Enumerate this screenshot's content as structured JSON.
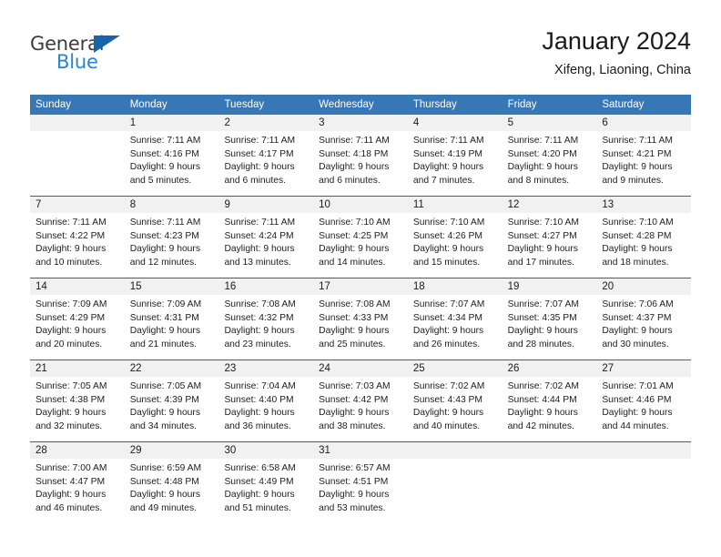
{
  "branding": {
    "name_part1": "General",
    "name_part2": "Blue",
    "triangle_icon": "triangle-icon",
    "accent_color": "#2c83cc",
    "logo_dark_color": "#3c3c3c"
  },
  "header": {
    "title": "January 2024",
    "subtitle": "Xifeng, Liaoning, China"
  },
  "theme": {
    "header_bg": "#3877b5",
    "header_text": "#ffffff",
    "week_divider": "#2167a8",
    "day_number_bg": "#f1f1f1"
  },
  "weekdays": [
    "Sunday",
    "Monday",
    "Tuesday",
    "Wednesday",
    "Thursday",
    "Friday",
    "Saturday"
  ],
  "weeks": [
    {
      "days": [
        {
          "num": "",
          "sunrise": "",
          "sunset": "",
          "daylight": "",
          "empty": true
        },
        {
          "num": "1",
          "sunrise": "Sunrise: 7:11 AM",
          "sunset": "Sunset: 4:16 PM",
          "daylight": "Daylight: 9 hours and 5 minutes.",
          "empty": false
        },
        {
          "num": "2",
          "sunrise": "Sunrise: 7:11 AM",
          "sunset": "Sunset: 4:17 PM",
          "daylight": "Daylight: 9 hours and 6 minutes.",
          "empty": false
        },
        {
          "num": "3",
          "sunrise": "Sunrise: 7:11 AM",
          "sunset": "Sunset: 4:18 PM",
          "daylight": "Daylight: 9 hours and 6 minutes.",
          "empty": false
        },
        {
          "num": "4",
          "sunrise": "Sunrise: 7:11 AM",
          "sunset": "Sunset: 4:19 PM",
          "daylight": "Daylight: 9 hours and 7 minutes.",
          "empty": false
        },
        {
          "num": "5",
          "sunrise": "Sunrise: 7:11 AM",
          "sunset": "Sunset: 4:20 PM",
          "daylight": "Daylight: 9 hours and 8 minutes.",
          "empty": false
        },
        {
          "num": "6",
          "sunrise": "Sunrise: 7:11 AM",
          "sunset": "Sunset: 4:21 PM",
          "daylight": "Daylight: 9 hours and 9 minutes.",
          "empty": false
        }
      ]
    },
    {
      "days": [
        {
          "num": "7",
          "sunrise": "Sunrise: 7:11 AM",
          "sunset": "Sunset: 4:22 PM",
          "daylight": "Daylight: 9 hours and 10 minutes.",
          "empty": false
        },
        {
          "num": "8",
          "sunrise": "Sunrise: 7:11 AM",
          "sunset": "Sunset: 4:23 PM",
          "daylight": "Daylight: 9 hours and 12 minutes.",
          "empty": false
        },
        {
          "num": "9",
          "sunrise": "Sunrise: 7:11 AM",
          "sunset": "Sunset: 4:24 PM",
          "daylight": "Daylight: 9 hours and 13 minutes.",
          "empty": false
        },
        {
          "num": "10",
          "sunrise": "Sunrise: 7:10 AM",
          "sunset": "Sunset: 4:25 PM",
          "daylight": "Daylight: 9 hours and 14 minutes.",
          "empty": false
        },
        {
          "num": "11",
          "sunrise": "Sunrise: 7:10 AM",
          "sunset": "Sunset: 4:26 PM",
          "daylight": "Daylight: 9 hours and 15 minutes.",
          "empty": false
        },
        {
          "num": "12",
          "sunrise": "Sunrise: 7:10 AM",
          "sunset": "Sunset: 4:27 PM",
          "daylight": "Daylight: 9 hours and 17 minutes.",
          "empty": false
        },
        {
          "num": "13",
          "sunrise": "Sunrise: 7:10 AM",
          "sunset": "Sunset: 4:28 PM",
          "daylight": "Daylight: 9 hours and 18 minutes.",
          "empty": false
        }
      ]
    },
    {
      "days": [
        {
          "num": "14",
          "sunrise": "Sunrise: 7:09 AM",
          "sunset": "Sunset: 4:29 PM",
          "daylight": "Daylight: 9 hours and 20 minutes.",
          "empty": false
        },
        {
          "num": "15",
          "sunrise": "Sunrise: 7:09 AM",
          "sunset": "Sunset: 4:31 PM",
          "daylight": "Daylight: 9 hours and 21 minutes.",
          "empty": false
        },
        {
          "num": "16",
          "sunrise": "Sunrise: 7:08 AM",
          "sunset": "Sunset: 4:32 PM",
          "daylight": "Daylight: 9 hours and 23 minutes.",
          "empty": false
        },
        {
          "num": "17",
          "sunrise": "Sunrise: 7:08 AM",
          "sunset": "Sunset: 4:33 PM",
          "daylight": "Daylight: 9 hours and 25 minutes.",
          "empty": false
        },
        {
          "num": "18",
          "sunrise": "Sunrise: 7:07 AM",
          "sunset": "Sunset: 4:34 PM",
          "daylight": "Daylight: 9 hours and 26 minutes.",
          "empty": false
        },
        {
          "num": "19",
          "sunrise": "Sunrise: 7:07 AM",
          "sunset": "Sunset: 4:35 PM",
          "daylight": "Daylight: 9 hours and 28 minutes.",
          "empty": false
        },
        {
          "num": "20",
          "sunrise": "Sunrise: 7:06 AM",
          "sunset": "Sunset: 4:37 PM",
          "daylight": "Daylight: 9 hours and 30 minutes.",
          "empty": false
        }
      ]
    },
    {
      "days": [
        {
          "num": "21",
          "sunrise": "Sunrise: 7:05 AM",
          "sunset": "Sunset: 4:38 PM",
          "daylight": "Daylight: 9 hours and 32 minutes.",
          "empty": false
        },
        {
          "num": "22",
          "sunrise": "Sunrise: 7:05 AM",
          "sunset": "Sunset: 4:39 PM",
          "daylight": "Daylight: 9 hours and 34 minutes.",
          "empty": false
        },
        {
          "num": "23",
          "sunrise": "Sunrise: 7:04 AM",
          "sunset": "Sunset: 4:40 PM",
          "daylight": "Daylight: 9 hours and 36 minutes.",
          "empty": false
        },
        {
          "num": "24",
          "sunrise": "Sunrise: 7:03 AM",
          "sunset": "Sunset: 4:42 PM",
          "daylight": "Daylight: 9 hours and 38 minutes.",
          "empty": false
        },
        {
          "num": "25",
          "sunrise": "Sunrise: 7:02 AM",
          "sunset": "Sunset: 4:43 PM",
          "daylight": "Daylight: 9 hours and 40 minutes.",
          "empty": false
        },
        {
          "num": "26",
          "sunrise": "Sunrise: 7:02 AM",
          "sunset": "Sunset: 4:44 PM",
          "daylight": "Daylight: 9 hours and 42 minutes.",
          "empty": false
        },
        {
          "num": "27",
          "sunrise": "Sunrise: 7:01 AM",
          "sunset": "Sunset: 4:46 PM",
          "daylight": "Daylight: 9 hours and 44 minutes.",
          "empty": false
        }
      ]
    },
    {
      "days": [
        {
          "num": "28",
          "sunrise": "Sunrise: 7:00 AM",
          "sunset": "Sunset: 4:47 PM",
          "daylight": "Daylight: 9 hours and 46 minutes.",
          "empty": false
        },
        {
          "num": "29",
          "sunrise": "Sunrise: 6:59 AM",
          "sunset": "Sunset: 4:48 PM",
          "daylight": "Daylight: 9 hours and 49 minutes.",
          "empty": false
        },
        {
          "num": "30",
          "sunrise": "Sunrise: 6:58 AM",
          "sunset": "Sunset: 4:49 PM",
          "daylight": "Daylight: 9 hours and 51 minutes.",
          "empty": false
        },
        {
          "num": "31",
          "sunrise": "Sunrise: 6:57 AM",
          "sunset": "Sunset: 4:51 PM",
          "daylight": "Daylight: 9 hours and 53 minutes.",
          "empty": false
        },
        {
          "num": "",
          "sunrise": "",
          "sunset": "",
          "daylight": "",
          "empty": true
        },
        {
          "num": "",
          "sunrise": "",
          "sunset": "",
          "daylight": "",
          "empty": true
        },
        {
          "num": "",
          "sunrise": "",
          "sunset": "",
          "daylight": "",
          "empty": true
        }
      ]
    }
  ]
}
